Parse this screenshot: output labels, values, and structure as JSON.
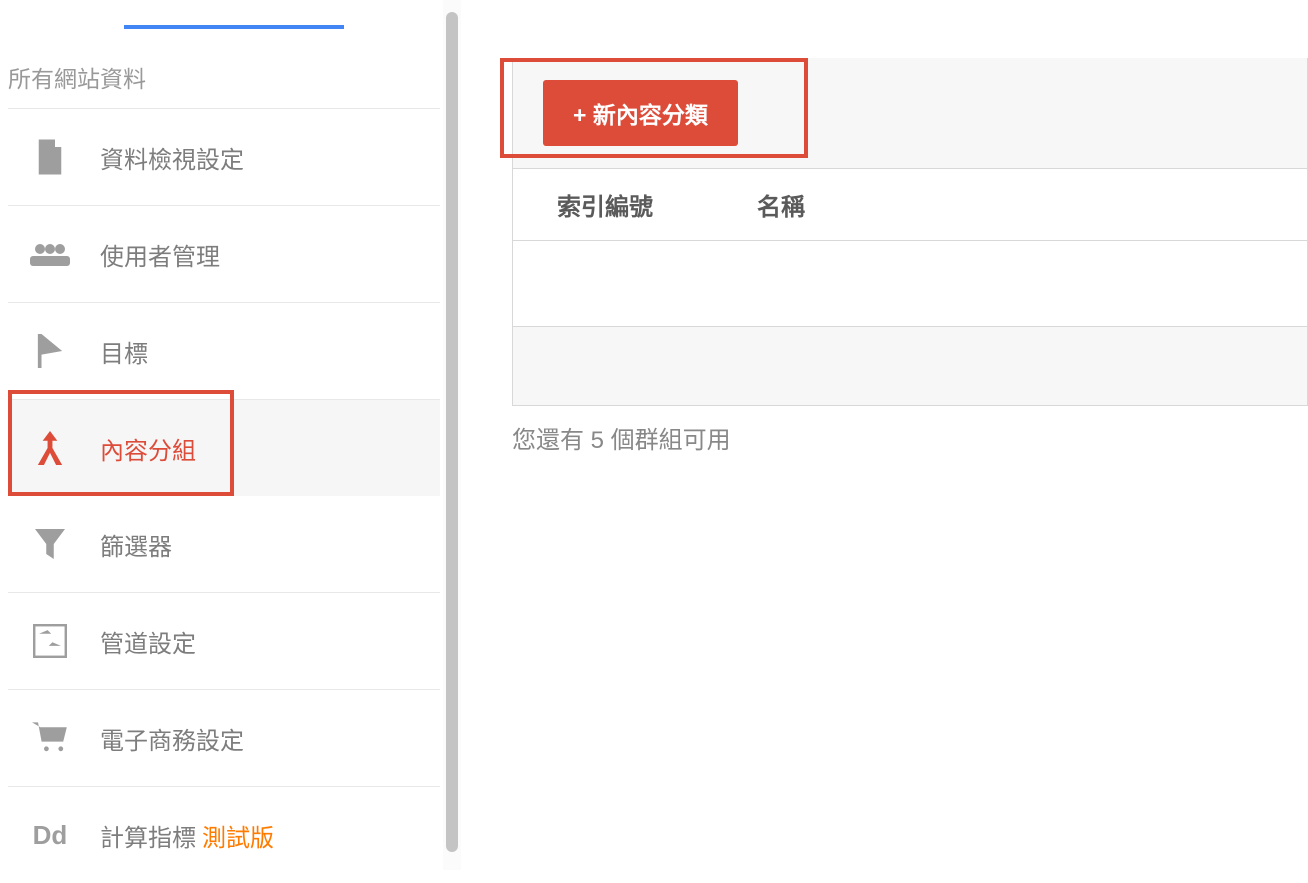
{
  "sidebar": {
    "header": "所有網站資料",
    "items": [
      {
        "icon": "file-icon",
        "label": "資料檢視設定"
      },
      {
        "icon": "users-icon",
        "label": "使用者管理"
      },
      {
        "icon": "flag-icon",
        "label": "目標"
      },
      {
        "icon": "merge-icon",
        "label": "內容分組",
        "active": true
      },
      {
        "icon": "filter-icon",
        "label": "篩選器"
      },
      {
        "icon": "channel-icon",
        "label": "管道設定"
      },
      {
        "icon": "cart-icon",
        "label": "電子商務設定"
      },
      {
        "icon": "dd-icon",
        "label": "計算指標",
        "badge": "測試版"
      }
    ]
  },
  "main": {
    "add_button_label": "+ 新內容分類",
    "table": {
      "columns": [
        "索引編號",
        "名稱"
      ]
    },
    "footer_note": "您還有 5 個群組可用"
  },
  "colors": {
    "accent": "#dd4b39",
    "link_blue": "#4285f4",
    "text_gray": "#7d7d7d"
  }
}
